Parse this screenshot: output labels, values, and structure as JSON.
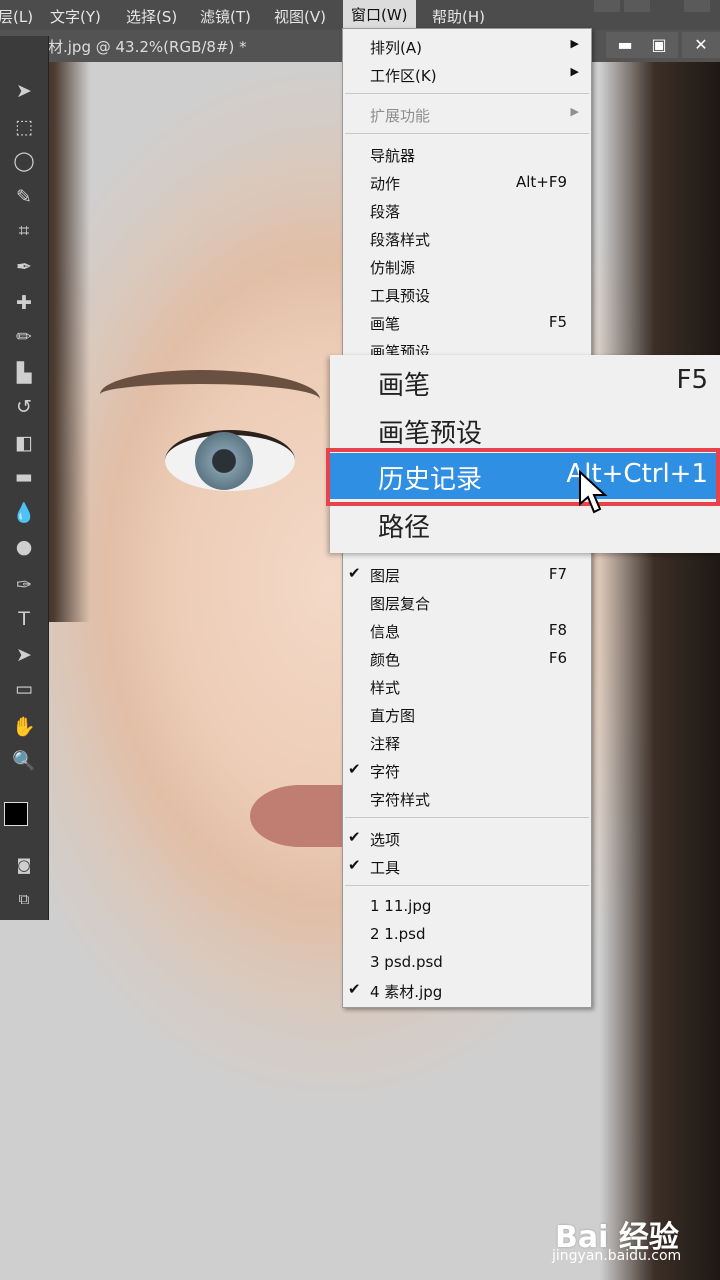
{
  "menubar": {
    "items": [
      "层(L)",
      "文字(Y)",
      "选择(S)",
      "滤镜(T)",
      "视图(V)",
      "窗口(W)",
      "帮助(H)"
    ]
  },
  "document_tab": {
    "title": "材.jpg @ 43.2%(RGB/8#) *"
  },
  "window_menu": {
    "items": [
      {
        "label": "排列(A)",
        "shortcut": "",
        "checked": false,
        "submenu": true
      },
      {
        "label": "工作区(K)",
        "shortcut": "",
        "checked": false,
        "submenu": true
      },
      {
        "label": "扩展功能",
        "shortcut": "",
        "checked": false,
        "submenu": true,
        "disabled": true
      },
      {
        "label": "导航器",
        "shortcut": "",
        "checked": false
      },
      {
        "label": "动作",
        "shortcut": "Alt+F9",
        "checked": false
      },
      {
        "label": "段落",
        "shortcut": "",
        "checked": false
      },
      {
        "label": "段落样式",
        "shortcut": "",
        "checked": false
      },
      {
        "label": "仿制源",
        "shortcut": "",
        "checked": false
      },
      {
        "label": "工具预设",
        "shortcut": "",
        "checked": false
      },
      {
        "label": "画笔",
        "shortcut": "F5",
        "checked": false
      },
      {
        "label": "画笔预设",
        "shortcut": "",
        "checked": false
      },
      {
        "label": "图层",
        "shortcut": "F7",
        "checked": true
      },
      {
        "label": "图层复合",
        "shortcut": "",
        "checked": false
      },
      {
        "label": "信息",
        "shortcut": "F8",
        "checked": false
      },
      {
        "label": "颜色",
        "shortcut": "F6",
        "checked": false
      },
      {
        "label": "样式",
        "shortcut": "",
        "checked": false
      },
      {
        "label": "直方图",
        "shortcut": "",
        "checked": false
      },
      {
        "label": "注释",
        "shortcut": "",
        "checked": false
      },
      {
        "label": "字符",
        "shortcut": "",
        "checked": true
      },
      {
        "label": "字符样式",
        "shortcut": "",
        "checked": false
      },
      {
        "label": "选项",
        "shortcut": "",
        "checked": true
      },
      {
        "label": "工具",
        "shortcut": "",
        "checked": true
      },
      {
        "label": "1 11.jpg",
        "shortcut": "",
        "checked": false
      },
      {
        "label": "2 1.psd",
        "shortcut": "",
        "checked": false
      },
      {
        "label": "3 psd.psd",
        "shortcut": "",
        "checked": false
      },
      {
        "label": "4 素材.jpg",
        "shortcut": "",
        "checked": true
      }
    ],
    "check_glyph": "✔",
    "submenu_glyph": "▶"
  },
  "zoom_callout": {
    "items": [
      {
        "label": "画笔",
        "shortcut": "F5"
      },
      {
        "label": "画笔预设",
        "shortcut": ""
      },
      {
        "label": "历史记录",
        "shortcut": "Alt+Ctrl+1",
        "highlighted": true
      },
      {
        "label": "路径",
        "shortcut": ""
      }
    ]
  },
  "watermark": {
    "brand": "Bai 经验",
    "url": "jingyan.baidu.com"
  },
  "colors": {
    "highlight": "#2f8fe2",
    "callout_border": "#e8424b",
    "menu_bg": "#f0f0f0"
  }
}
